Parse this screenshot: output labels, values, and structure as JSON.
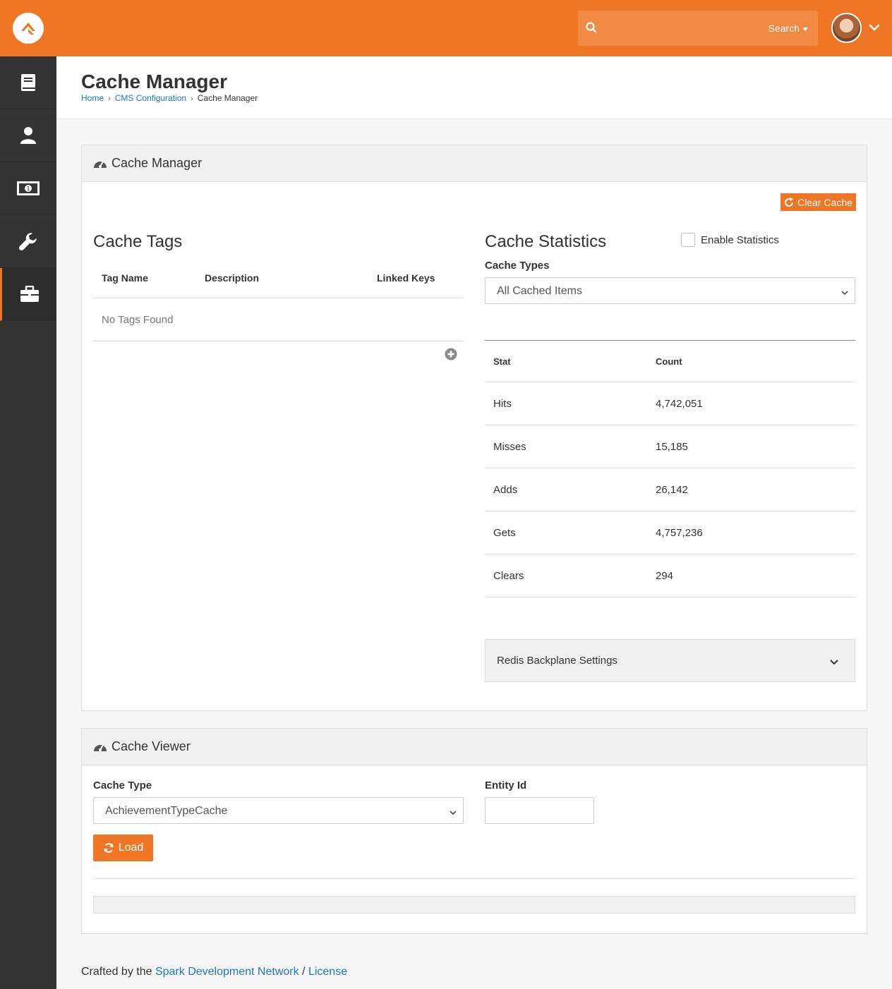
{
  "header": {
    "search_placeholder": "",
    "search_button_label": "Search"
  },
  "page": {
    "title": "Cache Manager",
    "breadcrumb": [
      "Home",
      "CMS Configuration",
      "Cache Manager"
    ]
  },
  "cache_manager_panel": {
    "title": "Cache Manager",
    "clear_cache_label": "Clear Cache",
    "tags": {
      "heading": "Cache Tags",
      "columns": [
        "Tag Name",
        "Description",
        "Linked Keys"
      ],
      "empty_text": "No Tags Found"
    },
    "statistics": {
      "heading": "Cache Statistics",
      "enable_label": "Enable Statistics",
      "enabled": false,
      "types_label": "Cache Types",
      "types_selected": "All Cached Items",
      "columns": [
        "Stat",
        "Count"
      ],
      "rows": [
        {
          "stat": "Hits",
          "count": "4,742,051"
        },
        {
          "stat": "Misses",
          "count": "15,185"
        },
        {
          "stat": "Adds",
          "count": "26,142"
        },
        {
          "stat": "Gets",
          "count": "4,757,236"
        },
        {
          "stat": "Clears",
          "count": "294"
        }
      ]
    },
    "redis_label": "Redis Backplane Settings"
  },
  "cache_viewer_panel": {
    "title": "Cache Viewer",
    "cache_type_label": "Cache Type",
    "cache_type_selected": "AchievementTypeCache",
    "entity_id_label": "Entity Id",
    "entity_id_value": "",
    "load_label": "Load"
  },
  "footer": {
    "prefix": "Crafted by the ",
    "link1": "Spark Development Network",
    "separator": " / ",
    "link2": "License"
  },
  "colors": {
    "brand": "#ee7624",
    "sidebar": "#343434",
    "link": "#2178b8"
  },
  "icons": [
    "rock-logo-icon",
    "search-icon",
    "caret-down-icon",
    "chevron-down-icon",
    "book-icon",
    "person-icon",
    "money-icon",
    "wrench-icon",
    "briefcase-icon",
    "dashboard-icon",
    "refresh-icon",
    "plus-circle-icon"
  ]
}
